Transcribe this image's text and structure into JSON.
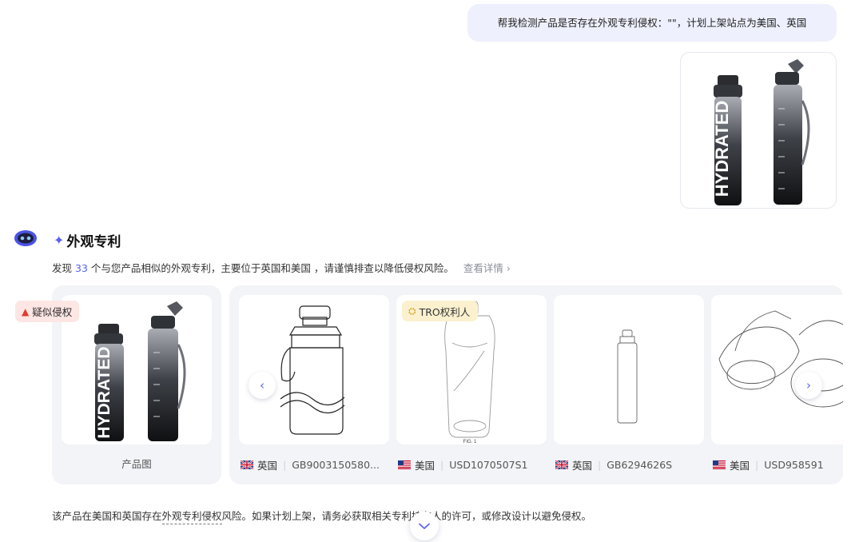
{
  "user_message": {
    "text": "帮我检测产品是否存在外观专利侵权：\"\"，计划上架站点为美国、英国"
  },
  "section": {
    "title": "外观专利",
    "summary_prefix": "发现",
    "summary_count": "33",
    "summary_suffix": "个与您产品相似的外观专利，主要位于英国和美国 ，请谨慎排查以降低侵权风险。",
    "detail_link": "查看详情 ›"
  },
  "product_card": {
    "tag": "疑似侵权",
    "label": "产品图"
  },
  "patents": [
    {
      "country": "英国",
      "flag": "uk",
      "number": "GB9003150580...",
      "tag": ""
    },
    {
      "country": "美国",
      "flag": "us",
      "number": "USD1070507S1",
      "tag": "TRO权利人"
    },
    {
      "country": "英国",
      "flag": "uk",
      "number": "GB6294626S",
      "tag": ""
    },
    {
      "country": "美国",
      "flag": "us",
      "number": "USD958591",
      "tag": ""
    }
  ],
  "conclusion": {
    "prefix": "该产品在美国和英国存在",
    "term": "外观专利侵权",
    "suffix": "风险。如果计划上架，请务必获取相关专利持有人的许可，或修改设计以避免侵权。"
  },
  "icons": {
    "prev": "chevron-left-icon",
    "next": "chevron-right-icon",
    "scroll": "chevron-down-icon",
    "warning": "warning-icon",
    "person": "person-icon"
  },
  "colors": {
    "accent": "#5461f0",
    "user_bubble": "#eef0fd",
    "warning": "#e5382f",
    "tro_bg": "#fbf1cf"
  }
}
